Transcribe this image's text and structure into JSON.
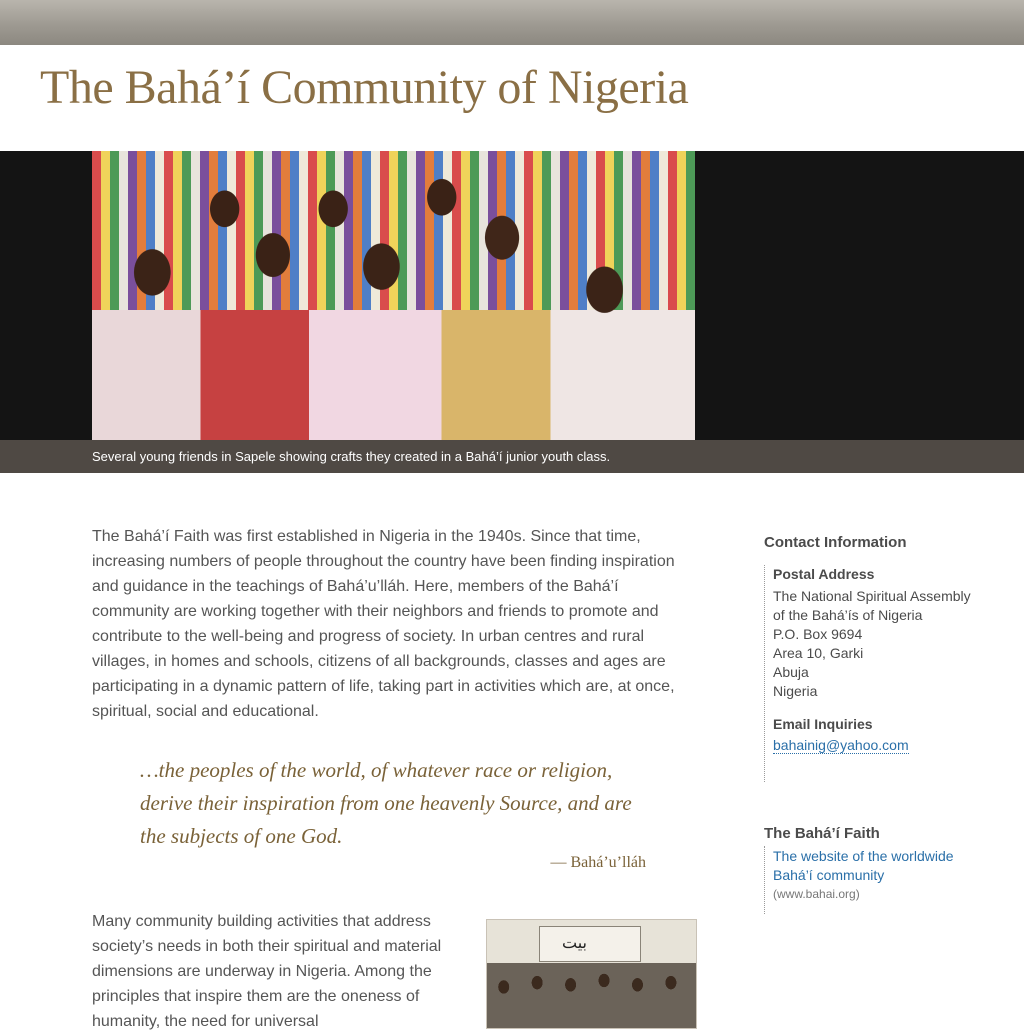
{
  "header": {
    "title": "The Bahá’í Community of Nigeria"
  },
  "hero": {
    "caption": "Several young friends in Sapele showing crafts they created in a Bahá’í junior youth class."
  },
  "main": {
    "intro": "The Bahá’í Faith was first established in Nigeria in the 1940s. Since that time, increasing numbers of people throughout the country have been finding inspiration and guidance in the teachings of Bahá’u’lláh. Here, members of the Bahá’í community are working together with their neighbors and friends to promote and contribute to the well-being and progress of society. In urban centres and rural villages, in homes and schools, citizens of all backgrounds, classes and ages are participating in a dynamic pattern of life, taking part in activities which are, at once, spiritual, social and educational.",
    "quote": "…the peoples of the world, of whatever race or religion, derive their inspiration from one heavenly Source, and are the subjects of one God.",
    "quote_attribution": "— Bahá’u’lláh",
    "body2": "Many community building activities that address society’s needs in both their spiritual and material dimensions are underway in Nigeria. Among the principles that inspire them are the oneness of humanity, the need for universal",
    "side_photo_sign": "بيت"
  },
  "sidebar": {
    "contact_heading": "Contact Information",
    "postal_label": "Postal Address",
    "address_lines": [
      "The National Spiritual Assembly",
      "of the Bahá’ís of Nigeria",
      "P.O. Box 9694",
      "Area 10, Garki",
      "Abuja",
      "Nigeria"
    ],
    "email_label": "Email Inquiries",
    "email": "bahainig@yahoo.com",
    "faith_heading": "The Bahá’í Faith",
    "faith_link": "The website of the worldwide Bahá’í community",
    "faith_url": "(www.bahai.org)"
  }
}
